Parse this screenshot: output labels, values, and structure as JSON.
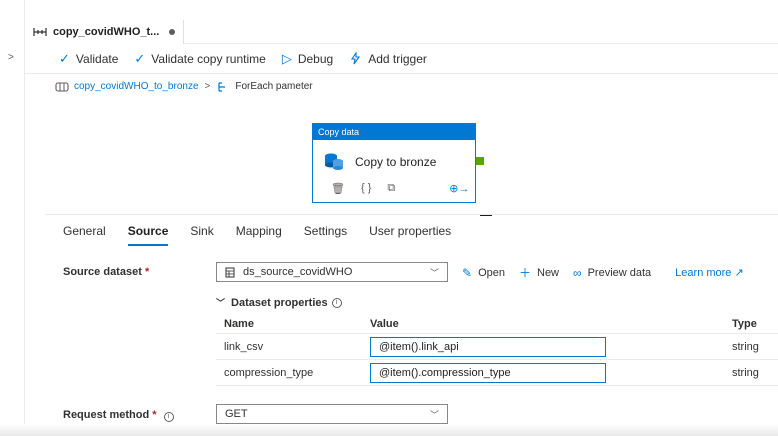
{
  "tab": {
    "title": "copy_covidWHO_t..."
  },
  "toolbar": {
    "validate": "Validate",
    "validate_runtime": "Validate copy runtime",
    "debug": "Debug",
    "add_trigger": "Add trigger"
  },
  "breadcrumb": {
    "pipeline": "copy_covidWHO_to_bronze",
    "separator": ">",
    "current": "ForEach pameter"
  },
  "activity": {
    "type_label": "Copy data",
    "name": "Copy to bronze"
  },
  "props_tabs": [
    "General",
    "Source",
    "Sink",
    "Mapping",
    "Settings",
    "User properties"
  ],
  "active_tab": "Source",
  "source": {
    "dataset_label": "Source dataset",
    "required_mark": "*",
    "dataset_value": "ds_source_covidWHO",
    "open": "Open",
    "new": "New",
    "preview": "Preview data",
    "learn_more": "Learn more",
    "ds_props_label": "Dataset properties",
    "columns": {
      "name": "Name",
      "value": "Value",
      "type": "Type"
    },
    "rows": [
      {
        "name": "link_csv",
        "value": "@item().link_api",
        "type": "string"
      },
      {
        "name": "compression_type",
        "value": "@item().compression_type",
        "type": "string"
      }
    ],
    "request_method_label": "Request method",
    "request_method_value": "GET"
  },
  "colors": {
    "accent": "#0078d4",
    "success": "#57a300",
    "required": "#a4262c"
  }
}
